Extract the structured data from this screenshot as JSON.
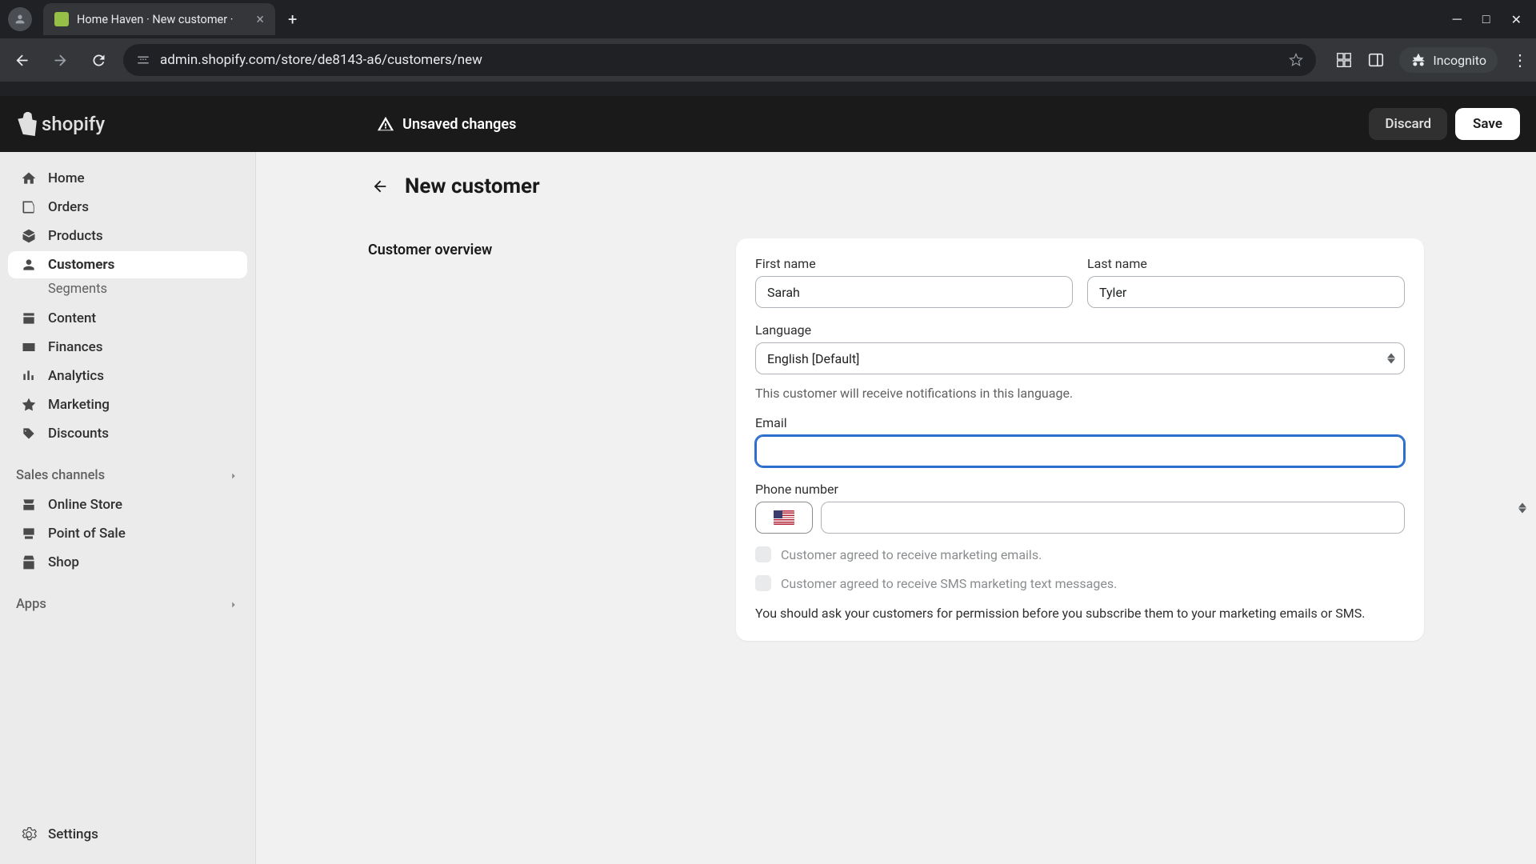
{
  "browser": {
    "tab_title": "Home Haven · New customer ·",
    "url": "admin.shopify.com/store/de8143-a6/customers/new",
    "incognito_label": "Incognito"
  },
  "topbar": {
    "unsaved_label": "Unsaved changes",
    "discard_label": "Discard",
    "save_label": "Save",
    "logo_text": "shopify"
  },
  "sidebar": {
    "home": "Home",
    "orders": "Orders",
    "products": "Products",
    "customers": "Customers",
    "segments": "Segments",
    "content": "Content",
    "finances": "Finances",
    "analytics": "Analytics",
    "marketing": "Marketing",
    "discounts": "Discounts",
    "sales_channels": "Sales channels",
    "online_store": "Online Store",
    "point_of_sale": "Point of Sale",
    "shop": "Shop",
    "apps": "Apps",
    "settings": "Settings"
  },
  "page": {
    "title": "New customer",
    "section_overview": "Customer overview"
  },
  "form": {
    "first_name_label": "First name",
    "first_name_value": "Sarah",
    "last_name_label": "Last name",
    "last_name_value": "Tyler",
    "language_label": "Language",
    "language_value": "English [Default]",
    "language_help": "This customer will receive notifications in this language.",
    "email_label": "Email",
    "email_value": "",
    "phone_label": "Phone number",
    "phone_value": "",
    "marketing_email_label": "Customer agreed to receive marketing emails.",
    "marketing_sms_label": "Customer agreed to receive SMS marketing text messages.",
    "marketing_note": "You should ask your customers for permission before you subscribe them to your marketing emails or SMS."
  }
}
